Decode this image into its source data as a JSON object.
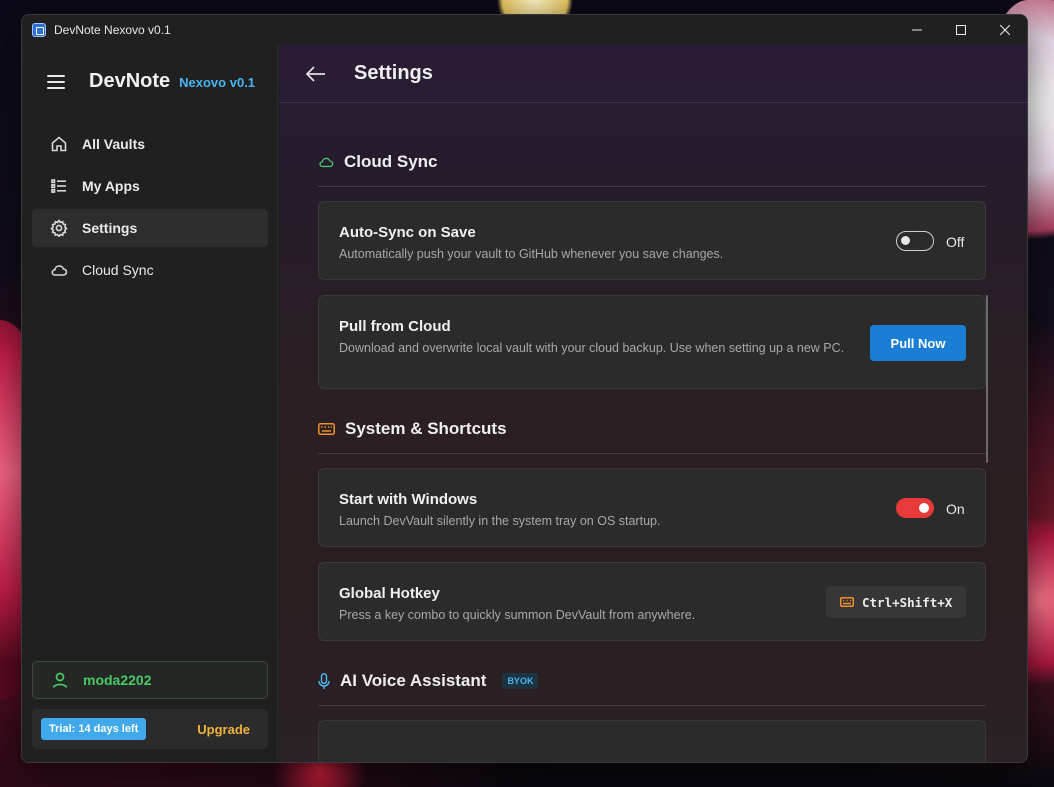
{
  "window": {
    "title": "DevNote Nexovo v0.1"
  },
  "sidebar": {
    "brand": "DevNote",
    "version": "Nexovo v0.1",
    "items": [
      {
        "label": "All Vaults",
        "icon": "home-icon"
      },
      {
        "label": "My Apps",
        "icon": "list-icon"
      },
      {
        "label": "Settings",
        "icon": "gear-icon",
        "active": true
      },
      {
        "label": "Cloud Sync",
        "icon": "cloud-icon"
      }
    ],
    "user": {
      "name": "moda2202"
    },
    "trial": {
      "badge": "Trial: 14 days left",
      "upgrade": "Upgrade"
    }
  },
  "main": {
    "title": "Settings",
    "sections": [
      {
        "title": "Cloud Sync",
        "icon": "cloud-icon",
        "cards": [
          {
            "title": "Auto-Sync on Save",
            "desc": "Automatically push your vault to GitHub whenever you save changes.",
            "toggle": "Off"
          },
          {
            "title": "Pull from Cloud",
            "desc": "Download and overwrite local vault with your cloud backup. Use when setting up a new PC.",
            "button": "Pull Now"
          }
        ]
      },
      {
        "title": "System & Shortcuts",
        "icon": "keyboard-icon",
        "cards": [
          {
            "title": "Start with Windows",
            "desc": "Launch DevVault silently in the system tray on OS startup.",
            "toggle": "On"
          },
          {
            "title": "Global Hotkey",
            "desc": "Press a key combo to quickly summon DevVault from anywhere.",
            "hotkey": "Ctrl+Shift+X"
          }
        ]
      },
      {
        "title": "AI Voice Assistant",
        "icon": "microphone-icon",
        "badge": "BYOK"
      }
    ]
  },
  "colors": {
    "accent_blue": "#1a7fd4",
    "version_blue": "#4ab3f0",
    "toggle_on": "#e83a3a",
    "user_green": "#4cc76a",
    "upgrade_gold": "#f0b43a",
    "hotkey_orange": "#f0902c"
  }
}
